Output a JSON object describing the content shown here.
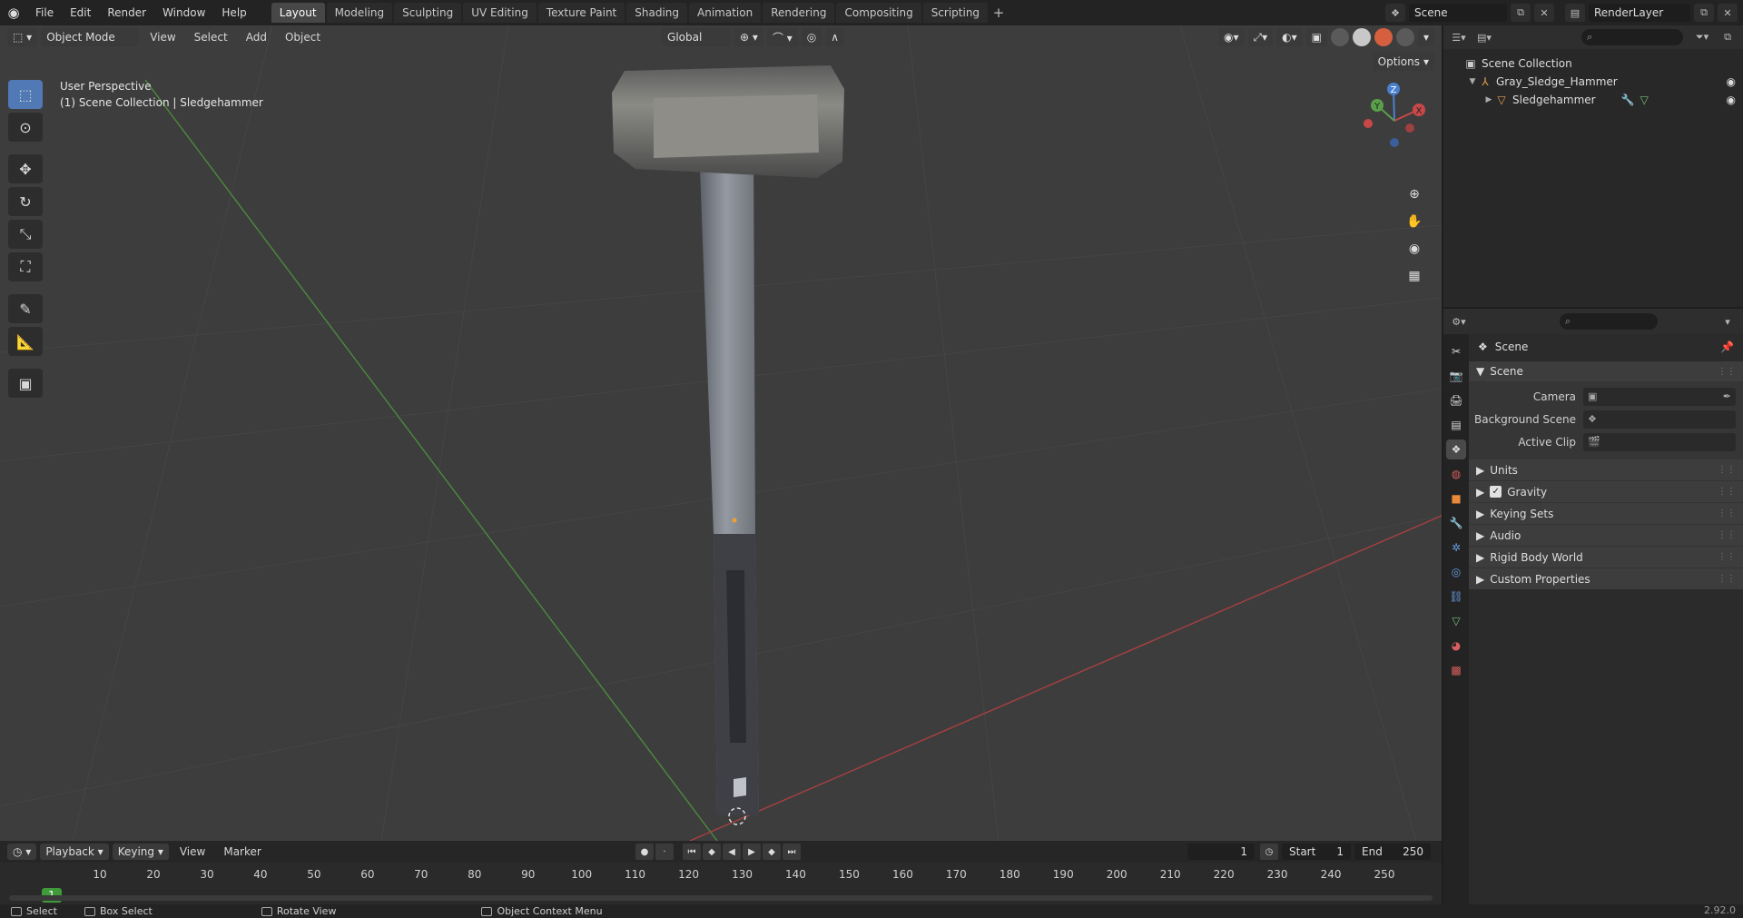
{
  "topbar": {
    "menus": [
      "File",
      "Edit",
      "Render",
      "Window",
      "Help"
    ],
    "workspaces": [
      "Layout",
      "Modeling",
      "Sculpting",
      "UV Editing",
      "Texture Paint",
      "Shading",
      "Animation",
      "Rendering",
      "Compositing",
      "Scripting"
    ],
    "active_workspace": "Layout",
    "add_tab": "+",
    "scene_name": "Scene",
    "view_layer": "RenderLayer"
  },
  "viewport": {
    "mode": "Object Mode",
    "menus": [
      "View",
      "Select",
      "Add",
      "Object"
    ],
    "transform_orientation": "Global",
    "options_label": "Options",
    "perspective_label": "User Perspective",
    "collection_label": "(1) Scene Collection | Sledgehammer",
    "gizmo": {
      "x": "X",
      "y": "Y",
      "z": "Z"
    }
  },
  "outliner": {
    "rows": [
      {
        "label": "Scene Collection"
      },
      {
        "label": "Gray_Sledge_Hammer"
      },
      {
        "label": "Sledgehammer"
      }
    ]
  },
  "properties": {
    "context": "Scene",
    "panel_title": "Scene",
    "fields": [
      {
        "label": "Camera"
      },
      {
        "label": "Background Scene"
      },
      {
        "label": "Active Clip"
      }
    ],
    "subpanels": [
      "Units",
      "Gravity",
      "Keying Sets",
      "Audio",
      "Rigid Body World",
      "Custom Properties"
    ],
    "gravity_enabled": true
  },
  "timeline": {
    "menus": [
      "Playback",
      "Keying",
      "View",
      "Marker"
    ],
    "current_frame": "1",
    "start_label": "Start",
    "start": "1",
    "end_label": "End",
    "end": "250",
    "ticks": [
      "10",
      "20",
      "30",
      "40",
      "50",
      "60",
      "70",
      "80",
      "90",
      "100",
      "110",
      "120",
      "130",
      "140",
      "150",
      "160",
      "170",
      "180",
      "190",
      "200",
      "210",
      "220",
      "230",
      "240",
      "250"
    ]
  },
  "statusbar": {
    "select": "Select",
    "box_select": "Box Select",
    "rotate_view": "Rotate View",
    "context_menu": "Object Context Menu",
    "version": "2.92.0"
  },
  "colors": {
    "accent": "#5179b5",
    "axis_x": "#c84848",
    "axis_y": "#5aa04a",
    "axis_z": "#4a7fd0",
    "frame_current": "#3f9b3a"
  }
}
